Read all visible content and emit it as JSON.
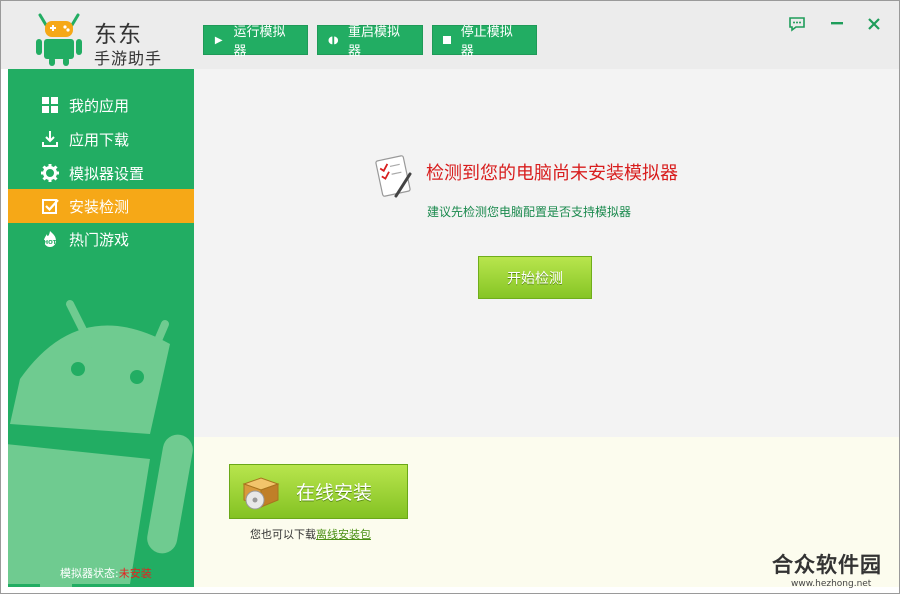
{
  "brand": {
    "line1": "东东",
    "line2": "手游助手"
  },
  "toolbar": {
    "run_label": "运行模拟器",
    "restart_label": "重启模拟器",
    "stop_label": "停止模拟器"
  },
  "window_controls": {
    "feedback": "feedback-icon",
    "minimize": "minimize-icon",
    "close": "close-icon"
  },
  "sidebar": {
    "items": [
      {
        "label": "我的应用",
        "icon": "grid-icon"
      },
      {
        "label": "应用下载",
        "icon": "download-icon"
      },
      {
        "label": "模拟器设置",
        "icon": "gear-icon"
      },
      {
        "label": "安装检测",
        "icon": "checkbox-icon",
        "active": true
      },
      {
        "label": "热门游戏",
        "icon": "hot-icon"
      }
    ],
    "status_label": "模拟器状态:",
    "status_value": "未安装"
  },
  "main": {
    "headline": "检测到您的电脑尚未安装模拟器",
    "subline": "建议先检测您电脑配置是否支持模拟器",
    "start_button": "开始检测",
    "online_button": "在线安装",
    "offline_prefix": "您也可以下载",
    "offline_link": "离线安装包"
  },
  "watermark": {
    "name": "合众软件园",
    "url": "www.hezhong.net"
  },
  "colors": {
    "green": "#22ad63",
    "active_orange": "#f6a817",
    "alert_red": "#d81e1e",
    "button_lime": "#9fd43a"
  }
}
